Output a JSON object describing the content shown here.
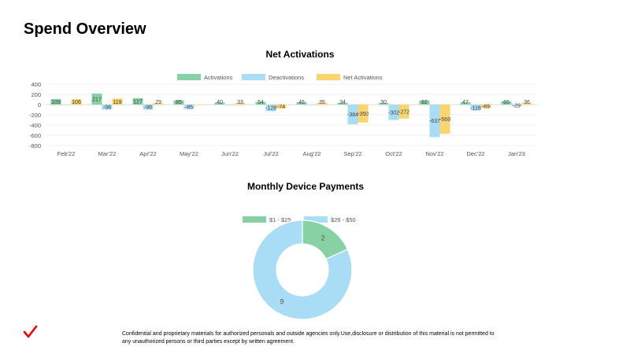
{
  "page": {
    "title": "Spend Overview",
    "footer": "Confidential and proprietary materials for authorized personals and outside agencies only.Use,disclosure or distribution of this material is not permitted to any unauthorized persons or third parties except by written agreement."
  },
  "brand": {
    "icon": "verizon-check-icon",
    "color": "#ee0000"
  },
  "chart_data": [
    {
      "type": "bar",
      "title": "Net Activations",
      "categories": [
        "Feb'22",
        "Mar'22",
        "Apr'22",
        "May'22",
        "Jun'22",
        "Jul'22",
        "Aug'22",
        "Sep'22",
        "Oct'22",
        "Nov'22",
        "Dec'22",
        "Jan'23"
      ],
      "series": [
        {
          "name": "Activations",
          "color": "#87d1a5",
          "values": [
            109,
            217,
            127,
            85,
            40,
            54,
            46,
            34,
            30,
            82,
            47,
            65
          ]
        },
        {
          "name": "Deactivations",
          "color": "#a9ddf5",
          "values": [
            0,
            -98,
            -98,
            -85,
            0,
            -128,
            0,
            -384,
            -302,
            -637,
            -116,
            -29
          ]
        },
        {
          "name": "Net Activations",
          "color": "#f8d56f",
          "values": [
            106,
            119,
            29,
            0,
            33,
            -74,
            35,
            -350,
            -272,
            -569,
            -69,
            36
          ]
        }
      ],
      "ylim": [
        -800,
        400
      ],
      "yticks": [
        400,
        200,
        0,
        -200,
        -400,
        -600,
        -800
      ],
      "legend": "top",
      "grid": true
    },
    {
      "type": "pie",
      "subtype": "donut",
      "title": "Monthly Device Payments",
      "labels": [
        "$1 - $25",
        "$26 - $50"
      ],
      "values": [
        2,
        9
      ],
      "colors": [
        "#87d1a5",
        "#a9ddf5"
      ],
      "legend": "top"
    }
  ]
}
